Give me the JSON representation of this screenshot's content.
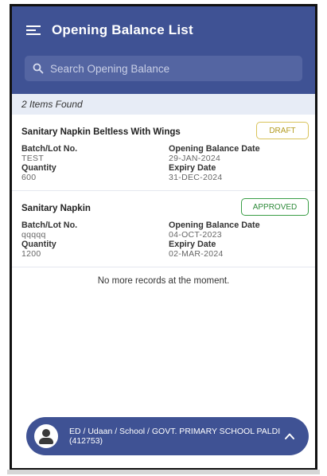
{
  "header": {
    "title": "Opening Balance List",
    "search_placeholder": "Search Opening Balance"
  },
  "results": {
    "count_text": "2 Items Found"
  },
  "items": [
    {
      "name": "Sanitary Napkin Beltless With Wings",
      "status": "DRAFT",
      "batch_label": "Batch/Lot No.",
      "batch_value": "TEST",
      "date_label": "Opening Balance Date",
      "date_value": "29-JAN-2024",
      "quantity_label": "Quantity",
      "quantity_value": "600",
      "expiry_label": "Expiry Date",
      "expiry_value": "31-DEC-2024"
    },
    {
      "name": "Sanitary Napkin",
      "status": "APPROVED",
      "batch_label": "Batch/Lot No.",
      "batch_value": "qqqqq",
      "date_label": "Opening Balance Date",
      "date_value": "04-OCT-2023",
      "quantity_label": "Quantity",
      "quantity_value": "1200",
      "expiry_label": "Expiry Date",
      "expiry_value": "02-MAR-2024"
    }
  ],
  "footer": {
    "no_more_text": "No more records at the moment.",
    "school_text": "ED / Udaan / School / GOVT. PRIMARY SCHOOL PALDI (412753)"
  },
  "colors": {
    "primary": "#3f5294",
    "count_bar_bg": "#e7ecf6",
    "draft": "#d9c35a",
    "approved": "#3a9e46"
  },
  "icons": {
    "menu": "menu-icon",
    "search": "search-icon",
    "avatar": "user-avatar-icon",
    "expand": "chevron-up-icon"
  }
}
